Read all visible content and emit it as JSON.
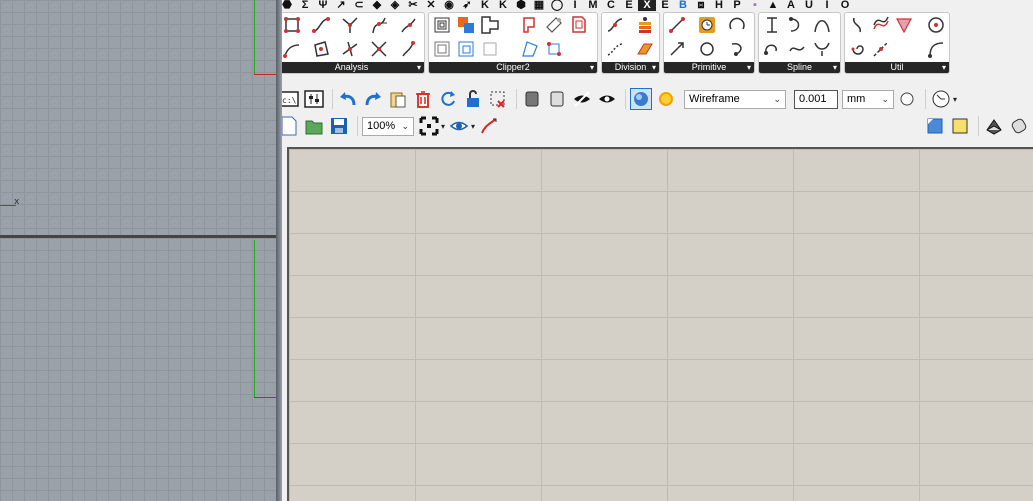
{
  "viewports": {
    "x_axis_label": "x"
  },
  "ribbon": {
    "tab_letters": [
      "I",
      "M",
      "C",
      "E",
      "B",
      "P",
      "A",
      "U",
      "I",
      "O"
    ],
    "panels": [
      {
        "label": "Analysis"
      },
      {
        "label": "Clipper2"
      },
      {
        "label": "Division"
      },
      {
        "label": "Primitive"
      },
      {
        "label": "Spline"
      },
      {
        "label": "Util"
      }
    ],
    "expand_glyph": "▾"
  },
  "toolbar": {
    "preview_mode": "Wireframe",
    "tolerance": "0.001",
    "units": "mm",
    "zoom": "100%",
    "chevron": "⌄"
  },
  "colors": {
    "accent": "#1e6fd0",
    "canvas": "#d4d0c8",
    "panel_label_bg": "#262626"
  }
}
